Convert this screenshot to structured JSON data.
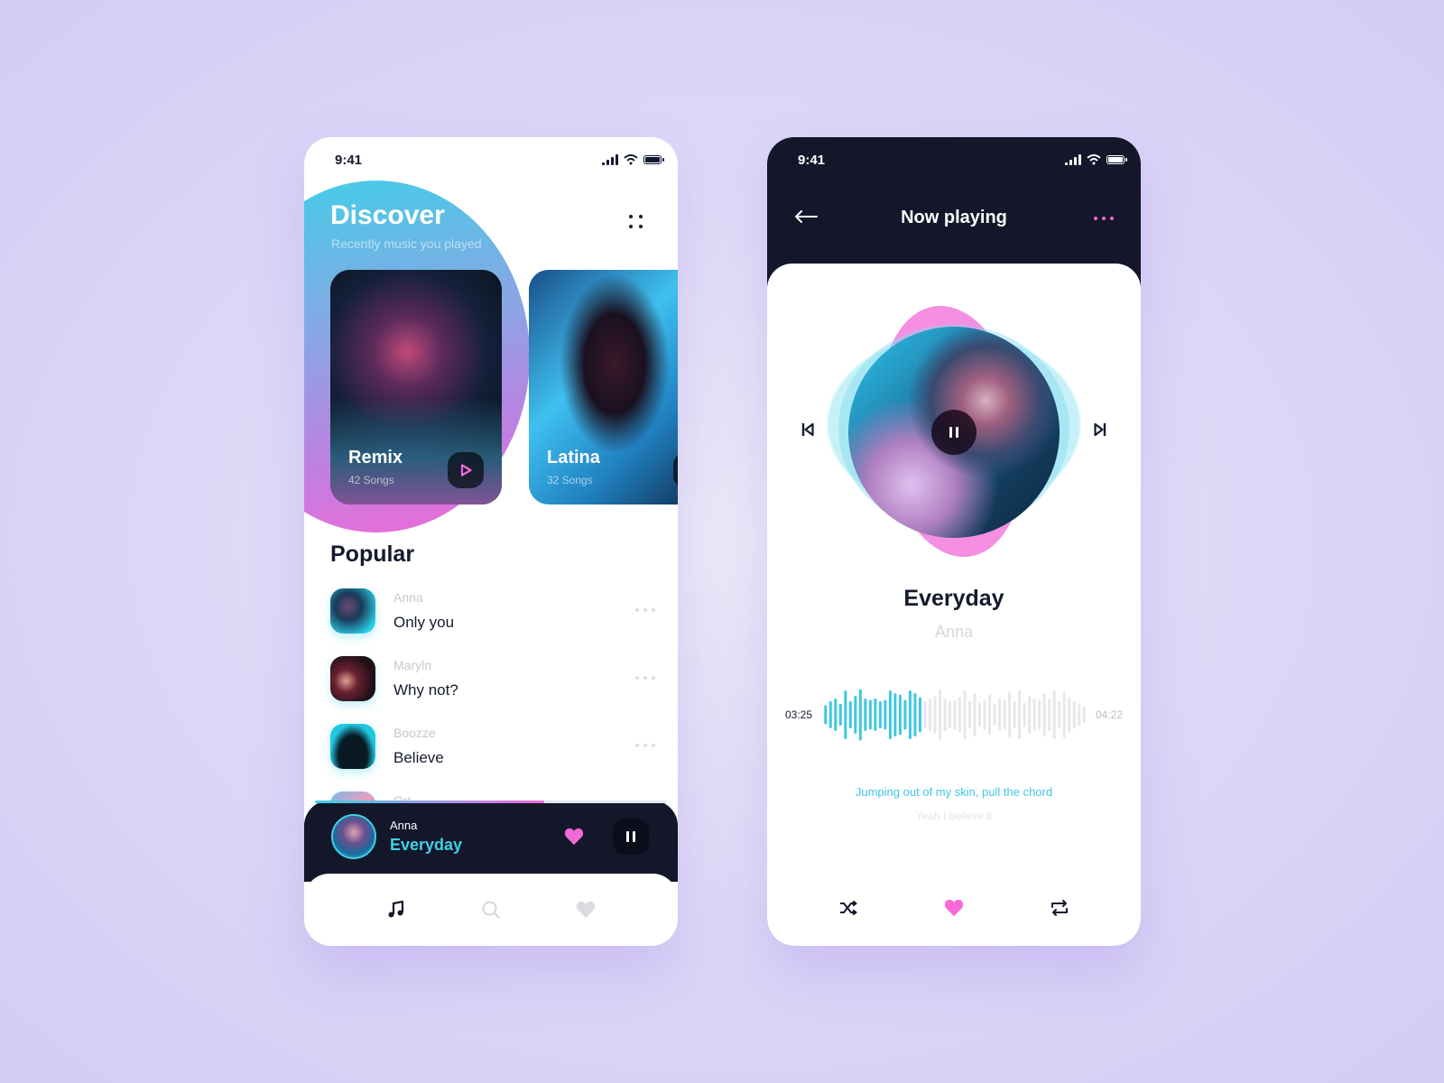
{
  "colors": {
    "accent_cyan": "#3fd0e6",
    "accent_pink": "#f06ad8",
    "dark": "#131729",
    "text_dark": "#141a2e",
    "muted": "#c8c8cc"
  },
  "discover_screen": {
    "status_time": "9:41",
    "title": "Discover",
    "subtitle": "Recently music you played",
    "menu_icon": "grid-dots-icon",
    "playlists": [
      {
        "name": "Remix",
        "count": "42 Songs",
        "icon": "play-icon"
      },
      {
        "name": "Latina",
        "count": "32 Songs",
        "icon": "play-icon"
      }
    ],
    "popular_title": "Popular",
    "popular": [
      {
        "artist": "Anna",
        "song": "Only you"
      },
      {
        "artist": "Maryln",
        "song": "Why not?"
      },
      {
        "artist": "Boozze",
        "song": "Believe"
      },
      {
        "artist": "Ort",
        "song": ""
      }
    ],
    "mini_player": {
      "artist": "Anna",
      "song": "Everyday",
      "progress_fraction": 0.65,
      "liked": true
    },
    "tabs": [
      {
        "name": "music",
        "icon": "music-note-icon",
        "active": true
      },
      {
        "name": "search",
        "icon": "search-icon",
        "active": false
      },
      {
        "name": "favorites",
        "icon": "heart-icon",
        "active": false
      }
    ]
  },
  "now_playing_screen": {
    "status_time": "9:41",
    "title": "Now playing",
    "song": "Everyday",
    "artist": "Anna",
    "current_time": "03:25",
    "total_time": "04:22",
    "progress_fraction": 0.37,
    "waveform": [
      0.35,
      0.5,
      0.6,
      0.4,
      0.9,
      0.5,
      0.7,
      0.95,
      0.6,
      0.55,
      0.6,
      0.5,
      0.55,
      0.9,
      0.8,
      0.75,
      0.55,
      0.9,
      0.8,
      0.65,
      0.5,
      0.6,
      0.7,
      0.95,
      0.6,
      0.5,
      0.55,
      0.65,
      0.9,
      0.5,
      0.8,
      0.45,
      0.55,
      0.75,
      0.4,
      0.6,
      0.55,
      0.85,
      0.5,
      0.9,
      0.45,
      0.7,
      0.6,
      0.55,
      0.8,
      0.6,
      0.9,
      0.5,
      0.85,
      0.65,
      0.5,
      0.4,
      0.3
    ],
    "lyrics": [
      "Jumping out of my skin, pull the chord",
      "Yeah I believe it"
    ],
    "controls": [
      {
        "name": "shuffle",
        "icon": "shuffle-icon"
      },
      {
        "name": "like",
        "icon": "heart-icon",
        "active": true
      },
      {
        "name": "repeat",
        "icon": "repeat-icon"
      }
    ]
  }
}
